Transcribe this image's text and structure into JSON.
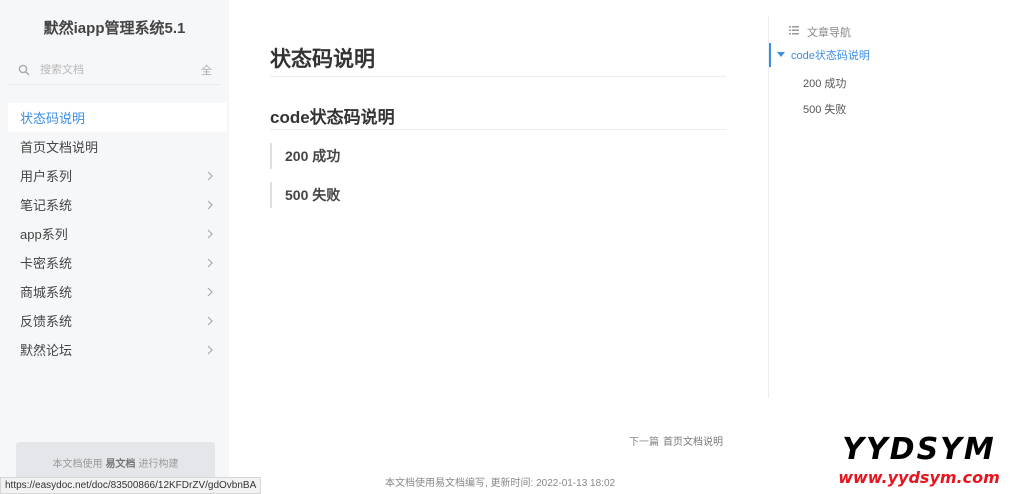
{
  "sidebar": {
    "site_title": "默然iapp管理系统5.1",
    "search": {
      "placeholder": "搜索文档",
      "all_label": "全"
    },
    "items": [
      {
        "label": "状态码说明",
        "active": true,
        "expandable": false
      },
      {
        "label": "首页文档说明",
        "active": false,
        "expandable": false
      },
      {
        "label": "用户系列",
        "active": false,
        "expandable": true
      },
      {
        "label": "笔记系统",
        "active": false,
        "expandable": true
      },
      {
        "label": "app系列",
        "active": false,
        "expandable": true
      },
      {
        "label": "卡密系统",
        "active": false,
        "expandable": true
      },
      {
        "label": "商城系统",
        "active": false,
        "expandable": true
      },
      {
        "label": "反馈系统",
        "active": false,
        "expandable": true
      },
      {
        "label": "默然论坛",
        "active": false,
        "expandable": true
      }
    ],
    "built_with": {
      "prefix": "本文档使用",
      "brand": "易文档",
      "suffix": "进行构建"
    }
  },
  "status_bar": {
    "url": "https://easydoc.net/doc/83500866/12KFDrZV/gdOvbnBA"
  },
  "content": {
    "title": "状态码说明",
    "section_title": "code状态码说明",
    "subsections": [
      "200 成功",
      "500 失败"
    ],
    "next": {
      "label": "下一篇",
      "title": "首页文档说明"
    },
    "footer": "本文档使用易文档编写, 更新时间: 2022-01-13 18:02"
  },
  "toc": {
    "heading": "文章导航",
    "active": "code状态码说明",
    "items": [
      "200 成功",
      "500 失败"
    ]
  },
  "watermark": {
    "big": "YYDSYM",
    "small": "www.yydsym.com"
  },
  "colors": {
    "accent": "#3a8ee6",
    "sidebar_bg": "#f6f7f9",
    "watermark_red": "#e8141e"
  }
}
